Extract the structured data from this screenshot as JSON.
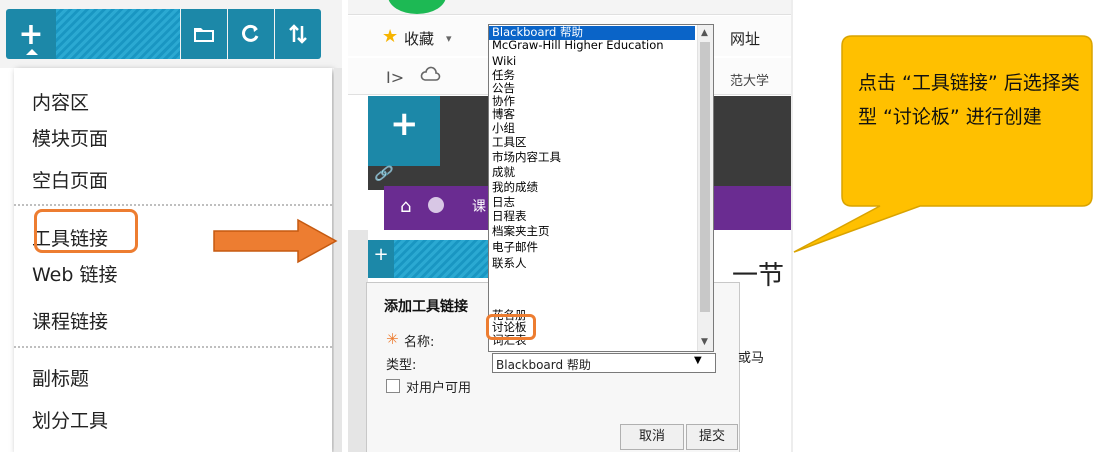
{
  "menu": {
    "items": [
      {
        "label": "内容区"
      },
      {
        "label": "模块页面"
      },
      {
        "label": "空白页面"
      },
      {
        "label": "工具链接"
      },
      {
        "label": "Web 链接"
      },
      {
        "label": "课程链接"
      },
      {
        "label": "副标题"
      },
      {
        "label": "划分工具"
      }
    ],
    "highlighted": "工具链接"
  },
  "browser": {
    "favorites_label": "收藏",
    "address_fragment": "网址",
    "nav_right_fragment": "范大学",
    "heading_fragment": "一节"
  },
  "dropdown": {
    "options": [
      "Blackboard 帮助",
      "McGraw-Hill Higher Education",
      "Wiki",
      "任务",
      "公告",
      "协作",
      "博客",
      "小组",
      "工具区",
      "市场内容工具",
      "成就",
      "我的成绩",
      "日志",
      "日程表",
      "档案夹主页",
      "电子邮件",
      "联系人",
      "花名册",
      "讨论板",
      "词汇表"
    ],
    "selected_index": 0,
    "highlighted": "讨论板"
  },
  "dialog": {
    "title": "添加工具链接",
    "name_label": "名称:",
    "type_label": "类型:",
    "type_value": "Blackboard 帮助",
    "available_label": "对用户可用",
    "cancel_label": "取消",
    "submit_label": "提交",
    "right_fragment": "或马"
  },
  "callout": {
    "text": "点击 “工具链接” 后选择类型 “讨论板” 进行创建"
  },
  "colors": {
    "accent_orange": "#ed7d31",
    "callout_yellow": "#ffc000",
    "teal": "#1c88a8",
    "purple": "#6a2c91",
    "selection_blue": "#0a64c8"
  }
}
